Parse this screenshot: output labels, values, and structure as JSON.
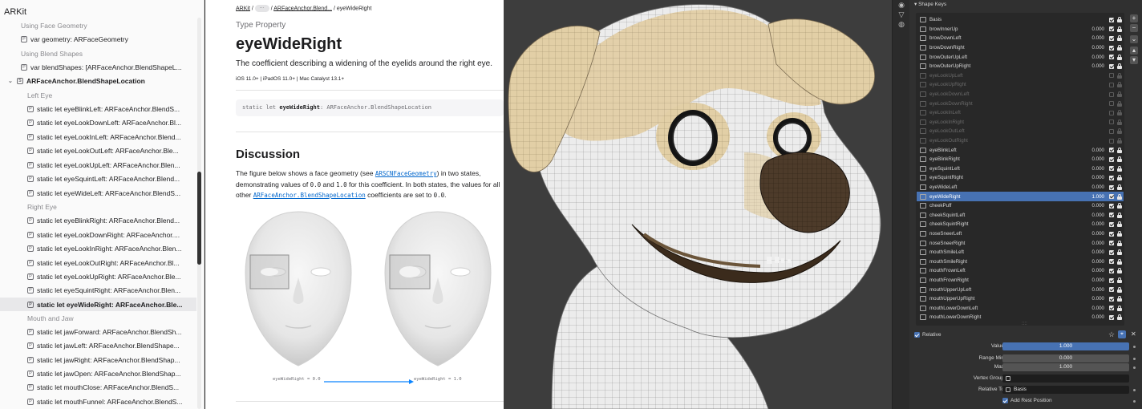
{
  "sidebar": {
    "title": "ARKit",
    "rows": [
      {
        "type": "head",
        "text": "Using Face Geometry",
        "indent": 26
      },
      {
        "type": "item",
        "badge": "P",
        "text": "var geometry: ARFaceGeometry",
        "indent": 26
      },
      {
        "type": "head",
        "text": "Using Blend Shapes",
        "indent": 26
      },
      {
        "type": "item",
        "badge": "P",
        "text": "var blendShapes: [ARFaceAnchor.BlendShapeL...",
        "indent": 26
      },
      {
        "type": "group",
        "badge": "S",
        "text": "ARFaceAnchor.BlendShapeLocation",
        "indent": 18
      },
      {
        "type": "head",
        "text": "Left Eye",
        "indent": 34
      },
      {
        "type": "item",
        "badge": "P",
        "text": "static let eyeBlinkLeft: ARFaceAnchor.BlendS...",
        "indent": 34
      },
      {
        "type": "item",
        "badge": "P",
        "text": "static let eyeLookDownLeft: ARFaceAnchor.Bl...",
        "indent": 34
      },
      {
        "type": "item",
        "badge": "P",
        "text": "static let eyeLookInLeft: ARFaceAnchor.Blend...",
        "indent": 34
      },
      {
        "type": "item",
        "badge": "P",
        "text": "static let eyeLookOutLeft: ARFaceAnchor.Ble...",
        "indent": 34
      },
      {
        "type": "item",
        "badge": "P",
        "text": "static let eyeLookUpLeft: ARFaceAnchor.Blen...",
        "indent": 34
      },
      {
        "type": "item",
        "badge": "P",
        "text": "static let eyeSquintLeft: ARFaceAnchor.Blend...",
        "indent": 34
      },
      {
        "type": "item",
        "badge": "P",
        "text": "static let eyeWideLeft: ARFaceAnchor.BlendS...",
        "indent": 34
      },
      {
        "type": "head",
        "text": "Right Eye",
        "indent": 34
      },
      {
        "type": "item",
        "badge": "P",
        "text": "static let eyeBlinkRight: ARFaceAnchor.Blend...",
        "indent": 34
      },
      {
        "type": "item",
        "badge": "P",
        "text": "static let eyeLookDownRight: ARFaceAnchor....",
        "indent": 34
      },
      {
        "type": "item",
        "badge": "P",
        "text": "static let eyeLookInRight: ARFaceAnchor.Blen...",
        "indent": 34
      },
      {
        "type": "item",
        "badge": "P",
        "text": "static let eyeLookOutRight: ARFaceAnchor.Bl...",
        "indent": 34
      },
      {
        "type": "item",
        "badge": "P",
        "text": "static let eyeLookUpRight: ARFaceAnchor.Ble...",
        "indent": 34
      },
      {
        "type": "item",
        "badge": "P",
        "text": "static let eyeSquintRight: ARFaceAnchor.Blen...",
        "indent": 34
      },
      {
        "type": "selected",
        "badge": "P",
        "text": "static let eyeWideRight: ARFaceAnchor.Ble...",
        "indent": 34
      },
      {
        "type": "head",
        "text": "Mouth and Jaw",
        "indent": 34
      },
      {
        "type": "item",
        "badge": "P",
        "text": "static let jawForward: ARFaceAnchor.BlendSh...",
        "indent": 34
      },
      {
        "type": "item",
        "badge": "P",
        "text": "static let jawLeft: ARFaceAnchor.BlendShape...",
        "indent": 34
      },
      {
        "type": "item",
        "badge": "P",
        "text": "static let jawRight: ARFaceAnchor.BlendShap...",
        "indent": 34
      },
      {
        "type": "item",
        "badge": "P",
        "text": "static let jawOpen: ARFaceAnchor.BlendShap...",
        "indent": 34
      },
      {
        "type": "item",
        "badge": "P",
        "text": "static let mouthClose: ARFaceAnchor.BlendS...",
        "indent": 34
      },
      {
        "type": "item",
        "badge": "P",
        "text": "static let mouthFunnel: ARFaceAnchor.BlendS...",
        "indent": 34
      }
    ]
  },
  "doc": {
    "breadcrumb": {
      "root": "ARKit",
      "ellipsis": "···",
      "parent": "ARFaceAnchor.Blend...",
      "current": "eyeWideRight"
    },
    "eyebrow": "Type Property",
    "title": "eyeWideRight",
    "abstract": "The coefficient describing a widening of the eyelids around the right eye.",
    "platforms": "iOS 11.0+  |  iPadOS 11.0+  |  Mac Catalyst 13.1+",
    "declaration": {
      "prefix": "static let ",
      "name": "eyeWideRight",
      "suffix": ": ARFaceAnchor.BlendShapeLocation"
    },
    "discussion_title": "Discussion",
    "discussion": {
      "t1": "The figure below shows a face geometry (see ",
      "link1": "ARSCNFaceGeometry",
      "t2": ") in two states, demonstrating values of ",
      "c1": "0.0",
      "t3": " and ",
      "c2": "1.0",
      "t4": " for this coefficient. In both states, the values for all other ",
      "link2": "ARFaceAnchor.BlendShapeLocation",
      "t5": " coefficients are set to ",
      "c3": "0.0",
      "t6": "."
    },
    "figure": {
      "label_left": "eyeWideRight = 0.0",
      "label_right": "eyeWideRight = 1.0"
    }
  },
  "panel": {
    "header": "Shape Keys",
    "shape_keys": [
      {
        "name": "Basis",
        "value": "",
        "muted": false
      },
      {
        "name": "browInnerUp",
        "value": "0.000",
        "muted": false
      },
      {
        "name": "browDownLeft",
        "value": "0.000",
        "muted": false
      },
      {
        "name": "browDownRight",
        "value": "0.000",
        "muted": false
      },
      {
        "name": "browOuterUpLeft",
        "value": "0.000",
        "muted": false
      },
      {
        "name": "browOuterUpRight",
        "value": "0.000",
        "muted": false
      },
      {
        "name": "eyeLookUpLeft",
        "value": "",
        "muted": true
      },
      {
        "name": "eyeLookUpRight",
        "value": "",
        "muted": true
      },
      {
        "name": "eyeLookDownLeft",
        "value": "",
        "muted": true
      },
      {
        "name": "eyeLookDownRight",
        "value": "",
        "muted": true
      },
      {
        "name": "eyeLookInLeft",
        "value": "",
        "muted": true
      },
      {
        "name": "eyeLookInRight",
        "value": "",
        "muted": true
      },
      {
        "name": "eyeLookOutLeft",
        "value": "",
        "muted": true
      },
      {
        "name": "eyeLookOutRight",
        "value": "",
        "muted": true
      },
      {
        "name": "eyeBlinkLeft",
        "value": "0.000",
        "muted": false
      },
      {
        "name": "eyeBlinkRight",
        "value": "0.000",
        "muted": false
      },
      {
        "name": "eyeSquintLeft",
        "value": "0.000",
        "muted": false
      },
      {
        "name": "eyeSquintRight",
        "value": "0.000",
        "muted": false
      },
      {
        "name": "eyeWideLeft",
        "value": "0.000",
        "muted": false
      },
      {
        "name": "eyeWideRight",
        "value": "1.000",
        "muted": false,
        "selected": true
      },
      {
        "name": "cheekPuff",
        "value": "0.000",
        "muted": false
      },
      {
        "name": "cheekSquintLeft",
        "value": "0.000",
        "muted": false
      },
      {
        "name": "cheekSquintRight",
        "value": "0.000",
        "muted": false
      },
      {
        "name": "noseSneerLeft",
        "value": "0.000",
        "muted": false
      },
      {
        "name": "noseSneerRight",
        "value": "0.000",
        "muted": false
      },
      {
        "name": "mouthSmileLeft",
        "value": "0.000",
        "muted": false
      },
      {
        "name": "mouthSmileRight",
        "value": "0.000",
        "muted": false
      },
      {
        "name": "mouthFrownLeft",
        "value": "0.000",
        "muted": false
      },
      {
        "name": "mouthFrownRight",
        "value": "0.000",
        "muted": false
      },
      {
        "name": "mouthUpperUpLeft",
        "value": "0.000",
        "muted": false
      },
      {
        "name": "mouthUpperUpRight",
        "value": "0.000",
        "muted": false
      },
      {
        "name": "mouthLowerDownLeft",
        "value": "0.000",
        "muted": false
      },
      {
        "name": "mouthLowerDownRight",
        "value": "0.000",
        "muted": false
      }
    ],
    "relative_label": "Relative",
    "value_label": "Value",
    "value": "1.000",
    "range_min_label": "Range Min",
    "range_min": "0.000",
    "max_label": "Max",
    "max": "1.000",
    "vertex_group_label": "Vertex Group",
    "vertex_group": "",
    "relative_to_label": "Relative To",
    "relative_to": "Basis",
    "add_rest_label": "Add Rest Position"
  },
  "colors": {
    "accent": "#4772b3",
    "link": "#0066cc",
    "viewport_bg": "#3d3d3d",
    "panel_bg": "#303030"
  }
}
